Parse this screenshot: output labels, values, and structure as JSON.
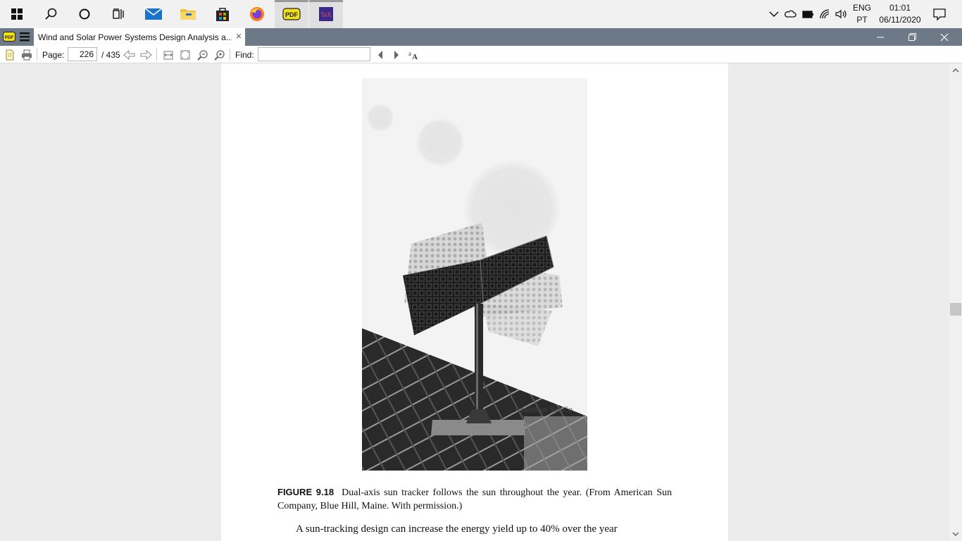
{
  "taskbar": {
    "apps": [
      {
        "name": "start",
        "label": "Start"
      },
      {
        "name": "search",
        "label": "Search"
      },
      {
        "name": "cortana",
        "label": "Cortana"
      },
      {
        "name": "task-view",
        "label": "Task View"
      },
      {
        "name": "mail",
        "label": "Mail"
      },
      {
        "name": "file-explorer",
        "label": "File Explorer"
      },
      {
        "name": "store",
        "label": "Microsoft Store"
      },
      {
        "name": "firefox",
        "label": "Firefox"
      },
      {
        "name": "pdf-reader",
        "label": "PDF"
      },
      {
        "name": "tex",
        "label": "TeX"
      }
    ],
    "lang_top": "ENG",
    "lang_bottom": "PT",
    "time": "01:01",
    "date": "06/11/2020"
  },
  "window": {
    "tab_title": "Wind and Solar Power Systems Design Analysis a...",
    "tab_close": "×",
    "minimize": "—",
    "restore": "❐",
    "close": "✕"
  },
  "toolbar": {
    "page_label": "Page:",
    "page_current": "226",
    "page_total": "/ 435",
    "find_label": "Find:",
    "find_value": ""
  },
  "document": {
    "figure_watermark": "American SunCo",
    "caption_label": "FIGURE 9.18",
    "caption_text": "Dual-axis sun tracker follows the sun throughout the year. (From American Sun Company, Blue Hill, Maine. With permission.)",
    "paragraph": "A sun-tracking design can increase the energy yield up to 40% over the year"
  },
  "colors": {
    "titlebar": "#6d7986",
    "taskbar": "#f1f1f1",
    "doc_bg": "#ececec"
  }
}
